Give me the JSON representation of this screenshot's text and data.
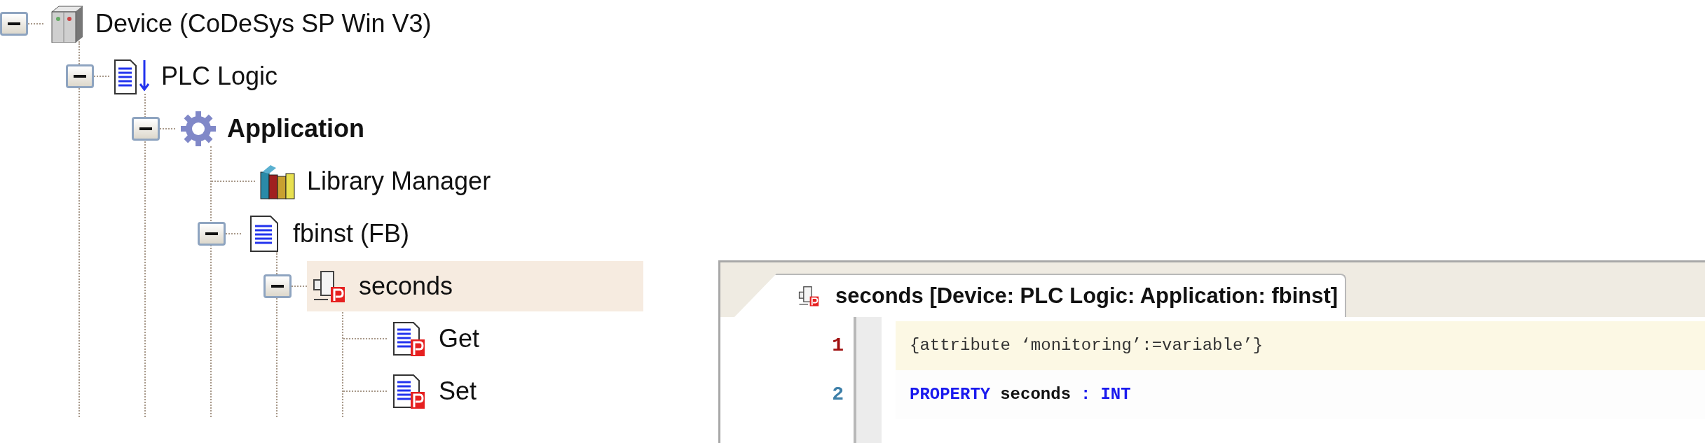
{
  "tree": [
    {
      "label": "Device (CoDeSys SP Win V3)",
      "kind": "device",
      "expanded": true,
      "active": false,
      "selected": false,
      "children": [
        {
          "label": "PLC Logic",
          "kind": "plc",
          "expanded": true,
          "active": false,
          "selected": false,
          "children": [
            {
              "label": "Application",
              "kind": "application",
              "expanded": true,
              "active": true,
              "selected": false,
              "children": [
                {
                  "label": "Library Manager",
                  "kind": "library",
                  "active": false,
                  "selected": false
                },
                {
                  "label": "fbinst (FB)",
                  "kind": "pou",
                  "expanded": true,
                  "active": false,
                  "selected": false,
                  "children": [
                    {
                      "label": "seconds",
                      "kind": "property",
                      "expanded": true,
                      "active": false,
                      "selected": true,
                      "children": [
                        {
                          "label": "Get",
                          "kind": "accessor",
                          "active": false,
                          "selected": false
                        },
                        {
                          "label": "Set",
                          "kind": "accessor",
                          "active": false,
                          "selected": false
                        }
                      ]
                    }
                  ]
                }
              ]
            }
          ]
        }
      ]
    }
  ],
  "editor": {
    "tab": {
      "title": "seconds [Device: PLC Logic: Application: fbinst]",
      "kind": "property",
      "selected": true
    },
    "lines": [
      {
        "number": "1",
        "highlighted": true,
        "tokens": [
          {
            "text": "{attribute ‘monitoring’:=variable’}",
            "kind": "pragma"
          }
        ]
      },
      {
        "number": "2",
        "highlighted": false,
        "tokens": [
          {
            "text": "PROPERTY",
            "kind": "keyword"
          },
          {
            "text": "seconds",
            "kind": "identifier"
          },
          {
            "text": ":",
            "kind": "operator"
          },
          {
            "text": "INT",
            "kind": "keyword"
          }
        ]
      }
    ]
  }
}
